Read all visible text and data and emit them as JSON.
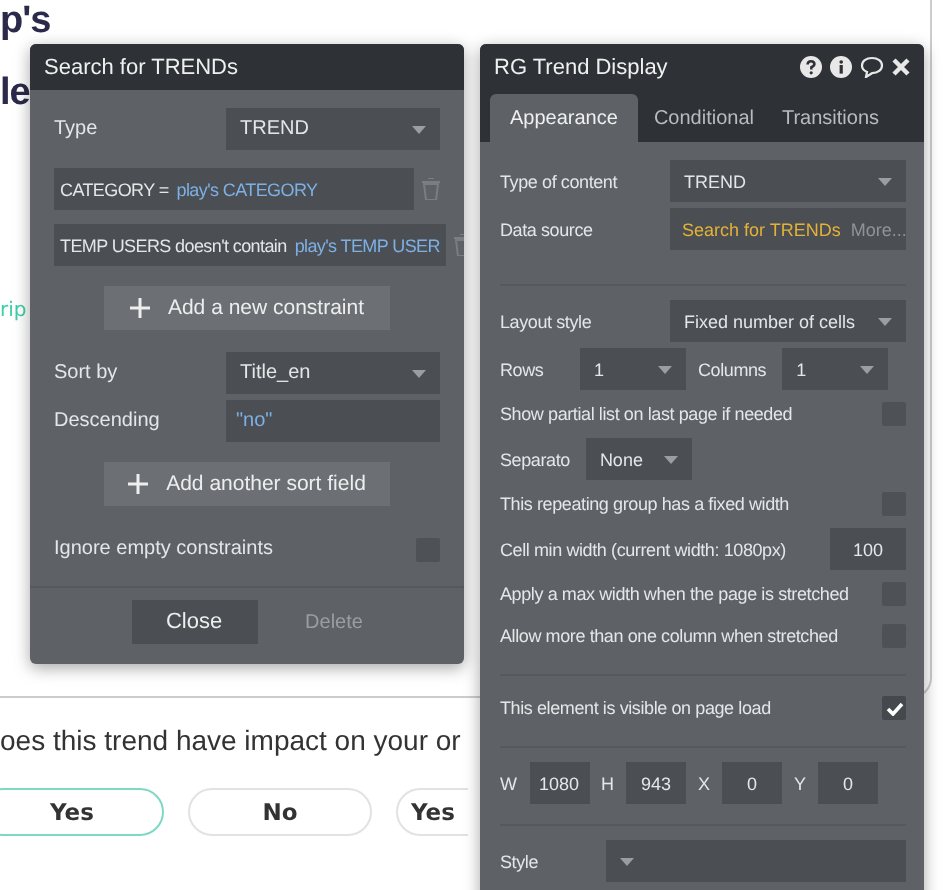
{
  "page": {
    "heading_lines": [
      "p's",
      "le"
    ],
    "link_fragment": "rip",
    "question": "oes this trend have impact on your or",
    "answers": [
      {
        "label": "Yes",
        "selected": true
      },
      {
        "label": "No",
        "selected": false
      },
      {
        "label": "Yes",
        "selected": false
      }
    ]
  },
  "search_panel": {
    "title": "Search for TRENDs",
    "type_label": "Type",
    "type_value": "TREND",
    "constraints": [
      {
        "text": "CATEGORY =",
        "value": "play's CATEGORY"
      },
      {
        "text": "TEMP USERS doesn't contain",
        "value": "play's TEMP USER"
      }
    ],
    "add_constraint": "Add a new constraint",
    "sort_label": "Sort by",
    "sort_value": "Title_en",
    "descending_label": "Descending",
    "descending_value": "\"no\"",
    "add_sort": "Add another sort field",
    "ignore_label": "Ignore empty constraints",
    "ignore_checked": false,
    "buttons": [
      {
        "label": "Close",
        "disabled": false
      },
      {
        "label": "Delete",
        "disabled": true
      }
    ]
  },
  "display_panel": {
    "title": "RG Trend Display",
    "tabs": [
      {
        "label": "Appearance",
        "selected": true
      },
      {
        "label": "Conditional",
        "selected": false
      },
      {
        "label": "Transitions",
        "selected": false
      }
    ],
    "sections": [
      [
        {
          "kind": "select",
          "label": "Type of content",
          "value": "TREND"
        },
        {
          "kind": "source",
          "label": "Data source",
          "value": "Search for TRENDs",
          "more": "More..."
        }
      ],
      [
        {
          "kind": "select",
          "label": "Layout style",
          "value": "Fixed number of cells"
        },
        {
          "kind": "grid",
          "rows_label": "Rows",
          "rows": "1",
          "columns_label": "Columns",
          "columns": "1"
        },
        {
          "kind": "checkbox",
          "label": "Show partial list on last page if needed",
          "checked": false
        },
        {
          "kind": "small_select",
          "label": "Separato",
          "value": "None"
        },
        {
          "kind": "checkbox",
          "label": "This repeating group has a fixed width",
          "checked": false
        },
        {
          "kind": "number",
          "label": "Cell min width (current width: 1080px)",
          "value": "100"
        },
        {
          "kind": "checkbox",
          "label": "Apply a max width when the page is stretched",
          "checked": false
        },
        {
          "kind": "checkbox",
          "label": "Allow more than one column when stretched",
          "checked": false
        }
      ],
      [
        {
          "kind": "checkbox",
          "label": "This element is visible on page load",
          "checked": true
        }
      ],
      [
        {
          "kind": "dims",
          "items": [
            {
              "label": "W",
              "value": "1080"
            },
            {
              "label": "H",
              "value": "943"
            },
            {
              "label": "X",
              "value": "0"
            },
            {
              "label": "Y",
              "value": "0"
            }
          ]
        }
      ],
      [
        {
          "kind": "select",
          "label": "Style"
        }
      ]
    ]
  }
}
